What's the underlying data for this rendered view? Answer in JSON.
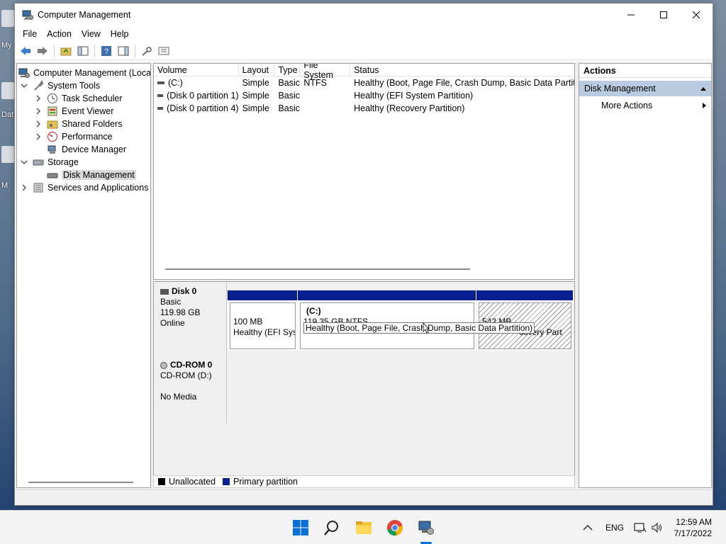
{
  "desktop": {
    "labels": [
      "My",
      "Dat",
      "M"
    ]
  },
  "window": {
    "title": "Computer Management",
    "menu": [
      "File",
      "Action",
      "View",
      "Help"
    ]
  },
  "tree": {
    "items": [
      {
        "label": "Computer Management (Local",
        "icon": "computer-management-icon"
      },
      {
        "label": "System Tools",
        "icon": "system-tools-icon"
      },
      {
        "label": "Task Scheduler",
        "icon": "clock-icon"
      },
      {
        "label": "Event Viewer",
        "icon": "event-viewer-icon"
      },
      {
        "label": "Shared Folders",
        "icon": "shared-folder-icon"
      },
      {
        "label": "Performance",
        "icon": "performance-icon"
      },
      {
        "label": "Device Manager",
        "icon": "device-manager-icon"
      },
      {
        "label": "Storage",
        "icon": "storage-icon"
      },
      {
        "label": "Disk Management",
        "icon": "disk-icon"
      },
      {
        "label": "Services and Applications",
        "icon": "services-icon"
      }
    ]
  },
  "volumes": {
    "columns": [
      "Volume",
      "Layout",
      "Type",
      "File System",
      "Status"
    ],
    "rows": [
      [
        "(C:)",
        "Simple",
        "Basic",
        "NTFS",
        "Healthy (Boot, Page File, Crash Dump, Basic Data Partition)"
      ],
      [
        "(Disk 0 partition 1)",
        "Simple",
        "Basic",
        "",
        "Healthy (EFI System Partition)"
      ],
      [
        "(Disk 0 partition 4)",
        "Simple",
        "Basic",
        "",
        "Healthy (Recovery Partition)"
      ]
    ]
  },
  "disk0": {
    "name": "Disk 0",
    "type": "Basic",
    "size": "119.98 GB",
    "status": "Online",
    "partitions": [
      {
        "title": "",
        "size": "100 MB",
        "status": "Healthy (EFI Sys"
      },
      {
        "title": "(C:)",
        "size": "119.35 GB NTFS",
        "status": "Healthy (Boot, Page File, Crash Dump, Basic Data Partition)"
      },
      {
        "title": "",
        "size": "542 MB",
        "status": "covery Part"
      }
    ],
    "tooltip": "Healthy (Boot, Page File, Crash Dump, Basic Data Partition)"
  },
  "cdrom": {
    "name": "CD-ROM 0",
    "drive": "CD-ROM (D:)",
    "status": "No Media"
  },
  "legend": [
    {
      "label": "Unallocated",
      "color": "#000000"
    },
    {
      "label": "Primary partition",
      "color": "#0a1f8f"
    }
  ],
  "actions": {
    "header": "Actions",
    "section": "Disk Management",
    "items": [
      "More Actions"
    ]
  },
  "taskbar": {
    "apps": [
      "windows-start-icon",
      "search-icon",
      "file-explorer-icon",
      "chrome-icon",
      "computer-management-icon"
    ],
    "lang": "ENG",
    "time": "12:59 AM",
    "date": "7/17/2022"
  }
}
